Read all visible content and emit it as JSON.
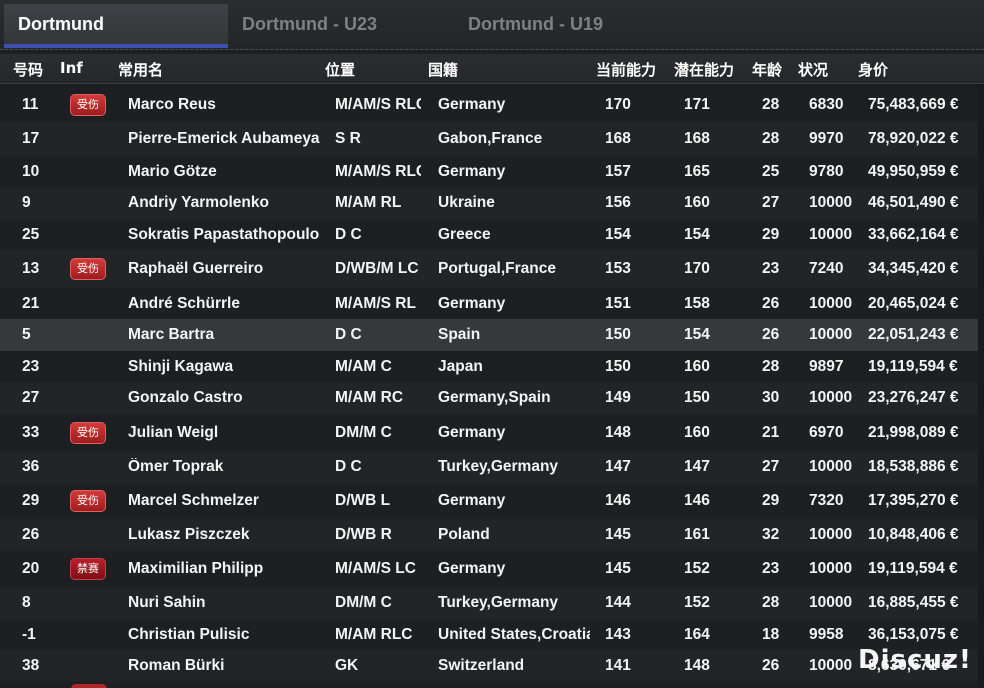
{
  "tabs": [
    "Dortmund",
    "Dortmund - U23",
    "Dortmund - U19"
  ],
  "columns": {
    "num": "号码",
    "inf": "Inf",
    "name": "常用名",
    "pos": "位置",
    "nat": "国籍",
    "ca": "当前能力",
    "pa": "潜在能力",
    "age": "年龄",
    "cond": "状况",
    "value": "身价"
  },
  "badge_labels": {
    "injured": "受伤",
    "banned": "禁赛"
  },
  "players": [
    {
      "num": "11",
      "inf": "受伤",
      "name": "Marco Reus",
      "pos": "M/AM/S RLC",
      "nat": "Germany",
      "ca": "170",
      "pa": "171",
      "age": "28",
      "cond": "6830",
      "value": "75,483,669 €"
    },
    {
      "num": "17",
      "inf": "",
      "name": "Pierre-Emerick Aubameyang",
      "pos": "S R",
      "nat": "Gabon,France",
      "ca": "168",
      "pa": "168",
      "age": "28",
      "cond": "9970",
      "value": "78,920,022 €"
    },
    {
      "num": "10",
      "inf": "",
      "name": "Mario Götze",
      "pos": "M/AM/S RLC",
      "nat": "Germany",
      "ca": "157",
      "pa": "165",
      "age": "25",
      "cond": "9780",
      "value": "49,950,959 €"
    },
    {
      "num": "9",
      "inf": "",
      "name": "Andriy Yarmolenko",
      "pos": "M/AM RL",
      "nat": "Ukraine",
      "ca": "156",
      "pa": "160",
      "age": "27",
      "cond": "10000",
      "value": "46,501,490 €"
    },
    {
      "num": "25",
      "inf": "",
      "name": "Sokratis Papastathopoulos",
      "pos": "D C",
      "nat": "Greece",
      "ca": "154",
      "pa": "154",
      "age": "29",
      "cond": "10000",
      "value": "33,662,164 €"
    },
    {
      "num": "13",
      "inf": "受伤",
      "name": "Raphaël Guerreiro",
      "pos": "D/WB/M LC",
      "nat": "Portugal,France",
      "ca": "153",
      "pa": "170",
      "age": "23",
      "cond": "7240",
      "value": "34,345,420 €"
    },
    {
      "num": "21",
      "inf": "",
      "name": "André Schürrle",
      "pos": "M/AM/S RL",
      "nat": "Germany",
      "ca": "151",
      "pa": "158",
      "age": "26",
      "cond": "10000",
      "value": "20,465,024 €"
    },
    {
      "num": "5",
      "inf": "",
      "name": "Marc Bartra",
      "pos": "D C",
      "nat": "Spain",
      "ca": "150",
      "pa": "154",
      "age": "26",
      "cond": "10000",
      "value": "22,051,243 €"
    },
    {
      "num": "23",
      "inf": "",
      "name": "Shinji Kagawa",
      "pos": "M/AM C",
      "nat": "Japan",
      "ca": "150",
      "pa": "160",
      "age": "28",
      "cond": "9897",
      "value": "19,119,594 €"
    },
    {
      "num": "27",
      "inf": "",
      "name": "Gonzalo Castro",
      "pos": "M/AM RC",
      "nat": "Germany,Spain",
      "ca": "149",
      "pa": "150",
      "age": "30",
      "cond": "10000",
      "value": "23,276,247 €"
    },
    {
      "num": "33",
      "inf": "受伤",
      "name": "Julian Weigl",
      "pos": "DM/M C",
      "nat": "Germany",
      "ca": "148",
      "pa": "160",
      "age": "21",
      "cond": "6970",
      "value": "21,998,089 €"
    },
    {
      "num": "36",
      "inf": "",
      "name": "Ömer Toprak",
      "pos": "D C",
      "nat": "Turkey,Germany",
      "ca": "147",
      "pa": "147",
      "age": "27",
      "cond": "10000",
      "value": "18,538,886 €"
    },
    {
      "num": "29",
      "inf": "受伤",
      "name": "Marcel Schmelzer",
      "pos": "D/WB L",
      "nat": "Germany",
      "ca": "146",
      "pa": "146",
      "age": "29",
      "cond": "7320",
      "value": "17,395,270 €"
    },
    {
      "num": "26",
      "inf": "",
      "name": "Lukasz Piszczek",
      "pos": "D/WB R",
      "nat": "Poland",
      "ca": "145",
      "pa": "161",
      "age": "32",
      "cond": "10000",
      "value": "10,848,406 €"
    },
    {
      "num": "20",
      "inf": "禁赛",
      "name": "Maximilian Philipp",
      "pos": "M/AM/S LC",
      "nat": "Germany",
      "ca": "145",
      "pa": "152",
      "age": "23",
      "cond": "10000",
      "value": "19,119,594 €"
    },
    {
      "num": "8",
      "inf": "",
      "name": "Nuri Sahin",
      "pos": "DM/M C",
      "nat": "Turkey,Germany",
      "ca": "144",
      "pa": "152",
      "age": "28",
      "cond": "10000",
      "value": "16,885,455 €"
    },
    {
      "num": "-1",
      "inf": "",
      "name": "Christian Pulisic",
      "pos": "M/AM RLC",
      "nat": "United States,Croatia",
      "ca": "143",
      "pa": "164",
      "age": "18",
      "cond": "9958",
      "value": "36,153,075 €"
    },
    {
      "num": "38",
      "inf": "",
      "name": "Roman Bürki",
      "pos": "GK",
      "nat": "Switzerland",
      "ca": "141",
      "pa": "148",
      "age": "26",
      "cond": "10000",
      "value": "8,630,671 €"
    }
  ],
  "selected_player": "Marc Bartra",
  "watermark": "Discuz!",
  "colors": {
    "tab_accent": "#3d4fb0",
    "injury_badge": "#c62c2c",
    "ban_badge": "#a0151f"
  }
}
